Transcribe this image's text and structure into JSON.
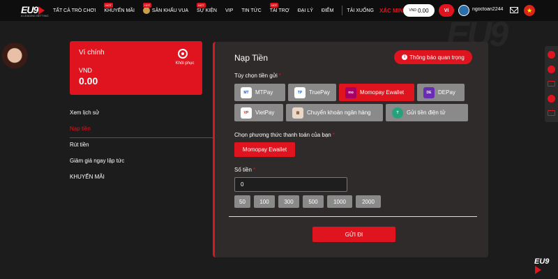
{
  "header": {
    "logo_text": "EU9",
    "logo_sub": "A LEADING BETTING",
    "nav": [
      {
        "label": "TẤT CẢ TRÒ CHƠI",
        "hot": ""
      },
      {
        "label": "KHUYẾN MÃI",
        "hot": "HOT"
      },
      {
        "label": "SÂN KHẤU VUA",
        "hot": "HOT"
      },
      {
        "label": "SỰ KIỆN",
        "hot": "HOT"
      },
      {
        "label": "VIP",
        "hot": ""
      },
      {
        "label": "TIN TỨC",
        "hot": ""
      },
      {
        "label": "TÀI TRỢ",
        "hot": "HOT"
      },
      {
        "label": "ĐẠI LÝ",
        "hot": ""
      },
      {
        "label": "ĐIỂM",
        "hot": ""
      },
      {
        "label": "TẢI XUỐNG",
        "hot": ""
      }
    ],
    "verify": "XÁC MINH NGAY",
    "balance_currency": "VND",
    "balance_value": "0.00",
    "wallet_button": "Ví",
    "username": "ngoctoan2244"
  },
  "wallet": {
    "title": "Ví chính",
    "restore_label": "Khôi phục",
    "currency": "VND",
    "amount": "0.00"
  },
  "side_menu": [
    {
      "label": "Xem lịch sử",
      "active": false
    },
    {
      "label": "Nạp tiền",
      "active": true
    },
    {
      "label": "Rút tiền",
      "active": false
    },
    {
      "label": "Giảm giá ngay lập tức",
      "active": false
    },
    {
      "label": "KHUYẾN MÃI",
      "active": false
    }
  ],
  "deposit": {
    "title": "Nạp Tiền",
    "notice_button": "Thông báo quan trọng",
    "options_label": "Tùy chọn tiền gửi",
    "options": [
      {
        "label": "MTPay",
        "selected": false,
        "icon": "mtpay-icon"
      },
      {
        "label": "TruePay",
        "selected": false,
        "icon": "truepay-icon"
      },
      {
        "label": "Momopay Ewallet",
        "selected": true,
        "icon": "momo-icon"
      },
      {
        "label": "DEPay",
        "selected": false,
        "icon": "depay-icon"
      },
      {
        "label": "VietPay",
        "selected": false,
        "icon": "vietpay-icon"
      },
      {
        "label": "Chuyển khoản ngân hàng",
        "selected": false,
        "icon": "bank-icon"
      },
      {
        "label": "Gửi tiền điện tử",
        "selected": false,
        "icon": "tether-icon"
      }
    ],
    "method_label": "Chọn phương thức thanh toán của bạn",
    "method_selected": "Momopay Ewallet",
    "amount_label": "Số tiền",
    "amount_value": "0",
    "quick_amounts": [
      "50",
      "100",
      "300",
      "500",
      "1000",
      "2000"
    ],
    "submit": "GỬI ĐI",
    "required_mark": "*"
  },
  "colors": {
    "accent": "#e0141e",
    "panel": "#2f2b2b",
    "background": "#1c1c1c"
  }
}
